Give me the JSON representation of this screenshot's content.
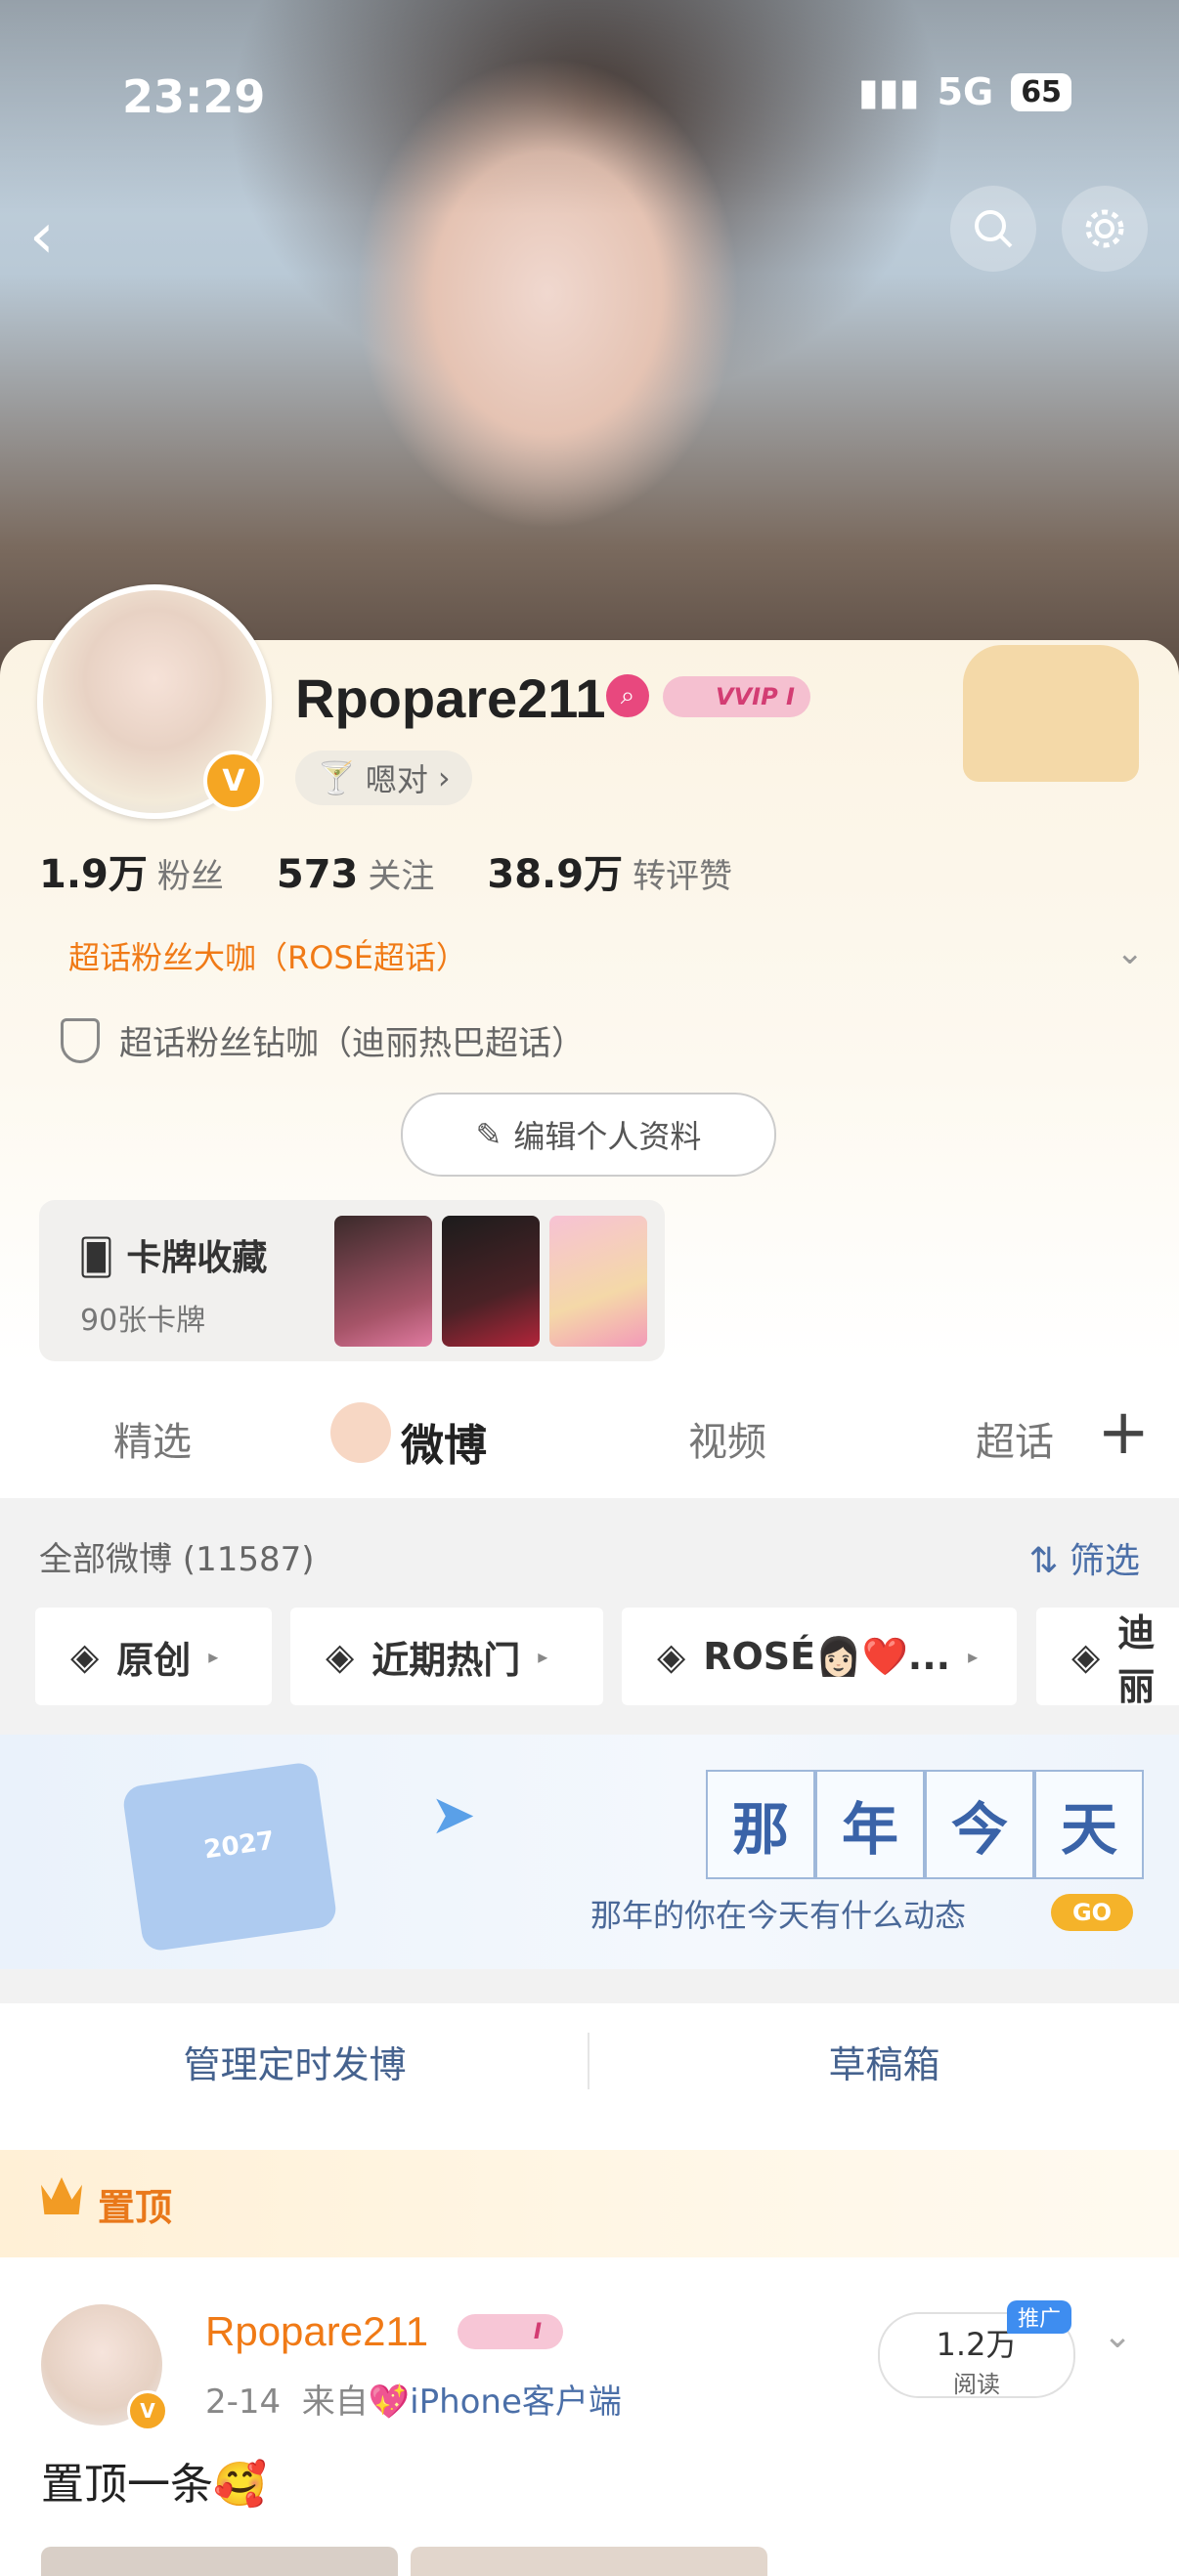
{
  "status_bar": {
    "time": "23:29",
    "network": "5G",
    "battery": "65"
  },
  "header": {
    "back_icon": "chevron-left-icon",
    "search_icon": "search-icon",
    "settings_icon": "gear-icon"
  },
  "profile": {
    "name": "Rpopare211",
    "vip_label": "VVIP I",
    "verified_mark": "V",
    "status_text": "嗯对",
    "stats": [
      {
        "num": "1.9万",
        "label": "粉丝"
      },
      {
        "num": "573",
        "label": "关注"
      },
      {
        "num": "38.9万",
        "label": "转评赞"
      }
    ],
    "badge_primary": "超话粉丝大咖（ROSÉ超话）",
    "badge_secondary": "超话粉丝钻咖（迪丽热巴超话）",
    "edit_button": "编辑个人资料",
    "cards_title": "卡牌收藏",
    "cards_count": "90张卡牌"
  },
  "tabs": [
    {
      "label": "精选"
    },
    {
      "label": "微博"
    },
    {
      "label": "视频"
    },
    {
      "label": "超话"
    }
  ],
  "feed": {
    "all_label": "全部微博 (11587)",
    "filter_label": "筛选",
    "chips": [
      "原创",
      "近期热门",
      "ROSÉ👩🏻❤️...",
      "迪丽"
    ],
    "banner_chars": [
      "那",
      "年",
      "今",
      "天"
    ],
    "banner_subtitle": "那年的你在今天有什么动态",
    "banner_go": "GO",
    "banner_year": "2027",
    "manage_scheduled": "管理定时发博",
    "drafts": "草稿箱",
    "pinned_label": "置顶"
  },
  "post": {
    "author": "Rpopare211",
    "badge": "I",
    "date": "2-14",
    "from": "来自",
    "source": "💖iPhone客户端",
    "reads_num": "1.2万",
    "reads_label": "阅读",
    "promo": "推广",
    "text": "置顶一条🥰"
  },
  "colors": {
    "accent_orange": "#f07a16",
    "link_blue": "#4b6fa8",
    "vip_pink": "#d33d73"
  }
}
